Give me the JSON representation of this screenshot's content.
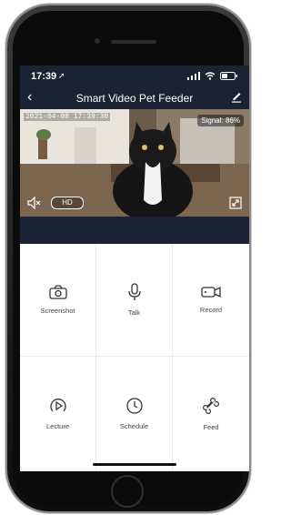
{
  "status_bar": {
    "time": "17:39"
  },
  "nav": {
    "title": "Smart Video Pet Feeder"
  },
  "video": {
    "timestamp": "2021-04-08 17:39:30",
    "signal": "Signal: 86%",
    "quality": "HD"
  },
  "actions": [
    {
      "label": "Screenshot",
      "icon": "camera-icon"
    },
    {
      "label": "Talk",
      "icon": "microphone-icon"
    },
    {
      "label": "Record",
      "icon": "video-camera-icon"
    },
    {
      "label": "Lecture",
      "icon": "play-circle-icon"
    },
    {
      "label": "Schedule",
      "icon": "clock-icon"
    },
    {
      "label": "Feed",
      "icon": "bone-icon"
    }
  ],
  "colors": {
    "header_bg": "#1b2233",
    "icon_stroke": "#333333"
  }
}
